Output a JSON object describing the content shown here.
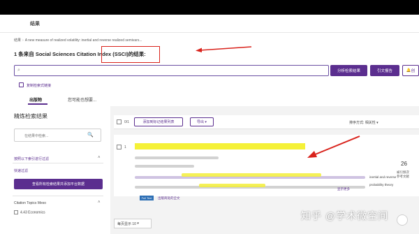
{
  "nav": {
    "results_link": "结果"
  },
  "breadcrumb": {
    "home": "结果",
    "current": "A new measure of realized volatility: inertial and reverse realized semivars..."
  },
  "page": {
    "title": "1 条来自 Social Sciences Citation Index (SSCI)的结果:"
  },
  "search": {
    "icon": "search-icon",
    "query": ""
  },
  "actions": {
    "analyze_label": "分析检索结果",
    "citation_report_label": "引文报告",
    "alert_label": "创"
  },
  "copy_link": {
    "label": "复制检索式链接"
  },
  "tabs": [
    {
      "label": "出版物",
      "active": true
    },
    {
      "label": "您可能也想要...",
      "active": false
    }
  ],
  "refine": {
    "title": "精炼检索结果",
    "placeholder": "在结果中检索...",
    "filter_label": "按照以下索引进行过滤",
    "quick_title": "快速过滤",
    "analyze_button": "查看所有检索结果并添加平台数据",
    "citation_topics": "Citation Topics Meso",
    "topic_item": "4.43 Economics"
  },
  "toolbar": {
    "count": "0/1",
    "add_to_list_label": "添加到标记结果列表",
    "export_label": "导出",
    "sort_label": "排序方式: 相关性"
  },
  "record": {
    "number": "1",
    "author_line": "inertial and reverse",
    "vol_line": "probability theory",
    "more_link": "显示更多",
    "view_full_link": "出版商处的全文",
    "full_text_badge": "Full Text",
    "citation_count": "26",
    "citation_label": "被引频次\n参考文献"
  },
  "pager": {
    "label": "每页显示 10"
  },
  "watermark": {
    "text": "知乎 @学术微空间"
  },
  "colors": {
    "accent": "#5b2e8f",
    "annotation_red": "#d9231c",
    "highlight": "#f4f022"
  }
}
